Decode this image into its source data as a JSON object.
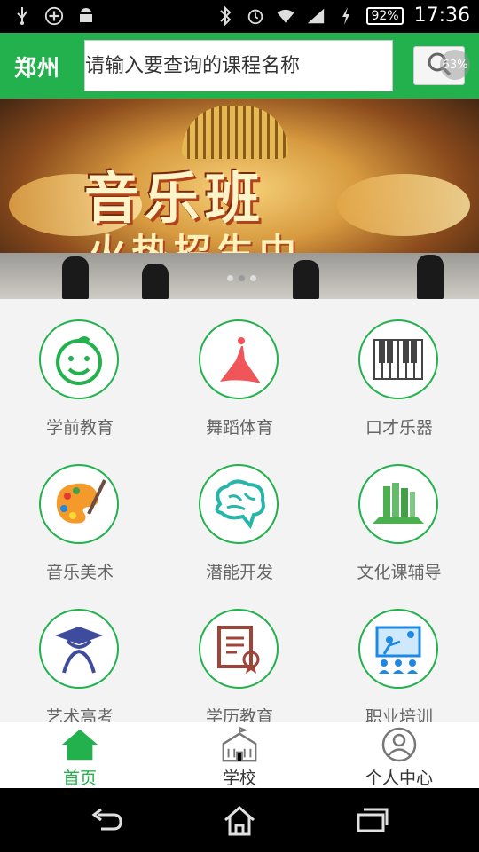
{
  "status_bar": {
    "battery": "92%",
    "time": "17:36"
  },
  "header": {
    "city": "郑州",
    "search_placeholder": "请输入要查询的课程名称",
    "overlay_percent": "63%"
  },
  "banner": {
    "title_line1": "音乐班",
    "title_line2": "火热招生中",
    "slide_count": 3,
    "active_slide": 2
  },
  "categories": [
    {
      "label": "学前教育",
      "icon": "baby-face-icon"
    },
    {
      "label": "舞蹈体育",
      "icon": "dancer-icon"
    },
    {
      "label": "口才乐器",
      "icon": "piano-icon"
    },
    {
      "label": "音乐美术",
      "icon": "palette-icon"
    },
    {
      "label": "潜能开发",
      "icon": "brain-icon"
    },
    {
      "label": "文化课辅导",
      "icon": "books-icon"
    },
    {
      "label": "艺术高考",
      "icon": "graduate-icon"
    },
    {
      "label": "学历教育",
      "icon": "certificate-icon"
    },
    {
      "label": "职业培训",
      "icon": "presentation-icon"
    }
  ],
  "tabs": [
    {
      "label": "首页",
      "icon": "home-icon",
      "active": true
    },
    {
      "label": "学校",
      "icon": "school-icon",
      "active": false
    },
    {
      "label": "个人中心",
      "icon": "profile-icon",
      "active": false
    }
  ],
  "colors": {
    "brand": "#22b14c",
    "text": "#666666"
  }
}
